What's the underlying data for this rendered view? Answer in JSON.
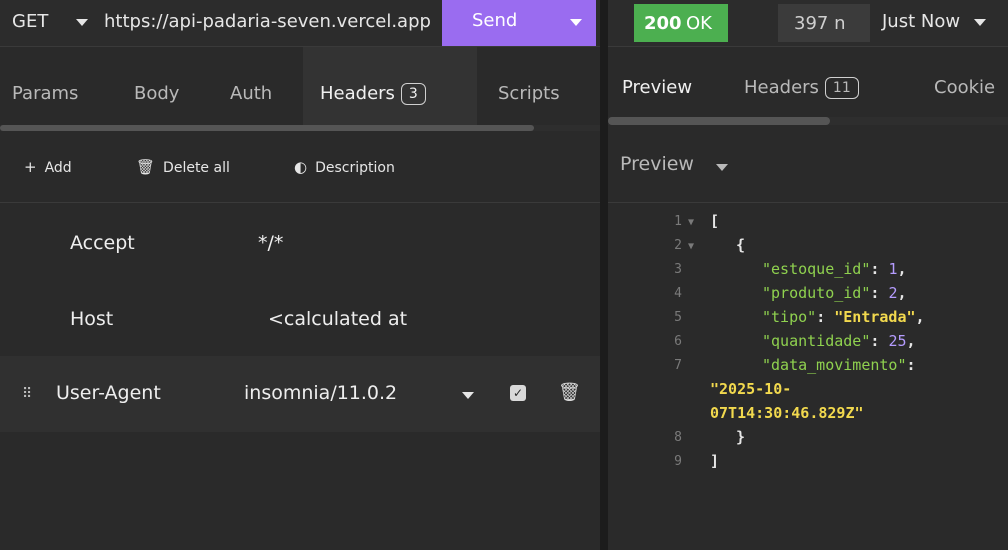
{
  "request": {
    "method": "GET",
    "url": "https://api-padaria-seven.vercel.app",
    "send_label": "Send"
  },
  "request_tabs": [
    {
      "label": "Params"
    },
    {
      "label": "Body"
    },
    {
      "label": "Auth"
    },
    {
      "label": "Headers",
      "badge": "3"
    },
    {
      "label": "Scripts"
    }
  ],
  "toolbar": {
    "add": "Add",
    "delete_all": "Delete all",
    "description": "Description"
  },
  "headers": [
    {
      "name": "Accept",
      "value": "*/*"
    },
    {
      "name": "Host",
      "value": "<calculated at"
    },
    {
      "name": "User-Agent",
      "value": "insomnia/11.0.2"
    }
  ],
  "response": {
    "status_code": "200",
    "status_text": "OK",
    "size": "397 n",
    "time": "Just Now"
  },
  "response_tabs": [
    {
      "label": "Preview"
    },
    {
      "label": "Headers",
      "badge": "11"
    },
    {
      "label": "Cookie"
    }
  ],
  "preview_mode": "Preview",
  "body_lines": [
    {
      "n": "1",
      "text": "["
    },
    {
      "n": "2",
      "text": "{"
    },
    {
      "n": "3",
      "key": "\"estoque_id\"",
      "num": "1"
    },
    {
      "n": "4",
      "key": "\"produto_id\"",
      "num": "2"
    },
    {
      "n": "5",
      "key": "\"tipo\"",
      "str": "\"Entrada\""
    },
    {
      "n": "6",
      "key": "\"quantidade\"",
      "num": "25"
    },
    {
      "n": "7",
      "key": "\"data_movimento\""
    },
    {
      "n": "",
      "str": "\"2025-10-"
    },
    {
      "n": "",
      "str": "07T14:30:46.829Z\""
    },
    {
      "n": "8",
      "text": "}"
    },
    {
      "n": "9",
      "text": "]"
    }
  ],
  "colors": {
    "send": "#9a6cf0",
    "status_ok": "#4caf50",
    "json_key": "#8fd14f",
    "json_number": "#b59cff",
    "json_string": "#f2d94e"
  }
}
